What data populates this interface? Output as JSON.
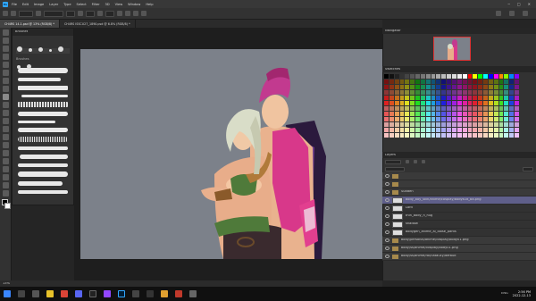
{
  "app": {
    "logo_text": "Ps"
  },
  "menu": [
    "File",
    "Edit",
    "Image",
    "Layer",
    "Type",
    "Select",
    "Filter",
    "3D",
    "View",
    "Window",
    "Help"
  ],
  "tabs": [
    {
      "label": "CH4RS 14.1.psd @ 13% (RGB/8) *",
      "active": true
    },
    {
      "label": "CH4RS ISSCU27_1890.psd @ 6.8% (RGB/8) *",
      "active": false
    }
  ],
  "brushes_panel": {
    "title": "Brushes",
    "folder_label": "Brushes"
  },
  "panels": {
    "navigator": "Navigator",
    "swatches": "Swatches",
    "layers": "Layers"
  },
  "layers": [
    {
      "label": "",
      "type": "group"
    },
    {
      "label": "",
      "type": "group"
    },
    {
      "label": "Sudden",
      "type": "group"
    },
    {
      "label": "body_boy_skin/anime/cosplay/bodysuit_ba.png",
      "type": "layer",
      "selected": true
    },
    {
      "label": "Lord",
      "type": "layer"
    },
    {
      "label": "thin_body_h_hug",
      "type": "layer"
    },
    {
      "label": "shadow",
      "type": "layer"
    },
    {
      "label": "bodygen_anime_ai_loose_pants",
      "type": "layer"
    },
    {
      "label": "body/personal/anime/cosplay/body01.png",
      "type": "group"
    },
    {
      "label": "body/ss/anime/cosplay/body01.png",
      "type": "group"
    },
    {
      "label": "body/ss/anime/roi/nataucy/default",
      "type": "group"
    }
  ],
  "status": {
    "zoom": "13%"
  },
  "taskbar": {
    "time": "2:56 PM",
    "date": "2022-12-13",
    "lang": "ENG"
  },
  "colors": {
    "hair": "#c23a8f",
    "artboard_bg": "#7c818a",
    "ps_blue": "#31a8ff"
  }
}
